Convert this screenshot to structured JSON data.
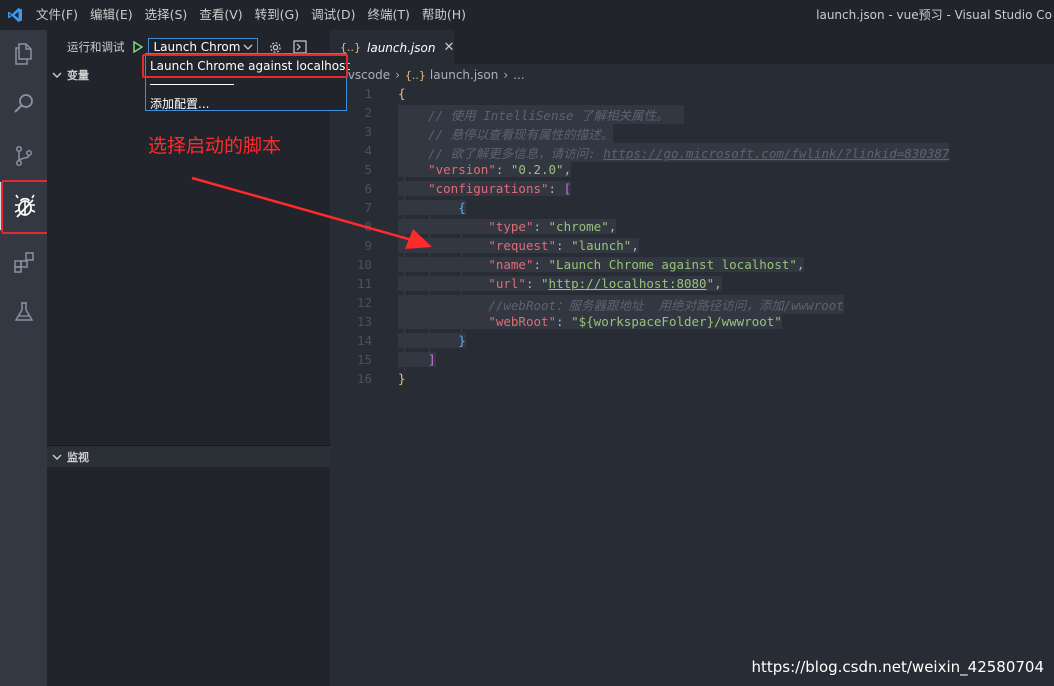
{
  "menu": [
    "文件(F)",
    "编辑(E)",
    "选择(S)",
    "查看(V)",
    "转到(G)",
    "调试(D)",
    "终端(T)",
    "帮助(H)"
  ],
  "window_title": "launch.json - vue预习 - Visual Studio Co",
  "activity_icons": [
    "files-icon",
    "search-icon",
    "source-control-icon",
    "debug-icon",
    "extensions-icon",
    "test-flask-icon"
  ],
  "sidebar": {
    "run_title": "运行和调试",
    "config_value": "Launch Chrom",
    "variables_label": "变量",
    "watch_label": "监视"
  },
  "dropdown": {
    "item1": "Launch Chrome against localhost",
    "item2": "添加配置..."
  },
  "editor": {
    "tab_icon": "{..}",
    "tab_label": "launch.json",
    "close_glyph": "✕",
    "breadcrumb": [
      ".vscode",
      "launch.json",
      "..."
    ]
  },
  "code_lines": [
    "1",
    "2",
    "3",
    "4",
    "5",
    "6",
    "7",
    "8",
    "9",
    "10",
    "11",
    "12",
    "13",
    "14",
    "15",
    "16"
  ],
  "code": {
    "l2": "// 使用 IntelliSense 了解相关属性。",
    "l3": "// 悬停以查看现有属性的描述。",
    "l4_prefix": "// 欲了解更多信息，请访问: ",
    "l4_link": "https://go.microsoft.com/fwlink/?linkid=830387",
    "version_key": "\"version\"",
    "version_val": "\"0.2.0\"",
    "configurations_key": "\"configurations\"",
    "type_key": "\"type\"",
    "type_val": "\"chrome\"",
    "request_key": "\"request\"",
    "request_val": "\"launch\"",
    "name_key": "\"name\"",
    "name_val": "\"Launch Chrome against localhost\"",
    "url_key": "\"url\"",
    "url_val": "http://localhost:8080",
    "l12": "//webRoot：服务器跟地址  用绝对路径访问，添加/wwwroot",
    "webroot_key": "\"webRoot\"",
    "webroot_val": "\"${workspaceFolder}/wwwroot\""
  },
  "annotation": "选择启动的脚本",
  "watermark": "https://blog.csdn.net/weixin_42580704",
  "colors": {
    "accent": "#3e8ede",
    "highlight_red": "#e32b2b",
    "annotation_red": "#ff2a2a"
  }
}
